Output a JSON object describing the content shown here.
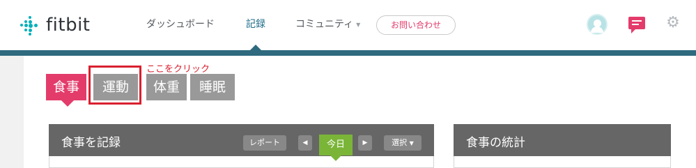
{
  "header": {
    "logo_text": "fitbit",
    "nav": [
      {
        "label": "ダッシュボード"
      },
      {
        "label": "記録"
      },
      {
        "label": "コミュニティ"
      }
    ],
    "contact_label": "お問い合わせ"
  },
  "tabs": [
    {
      "label": "食事"
    },
    {
      "label": "運動"
    },
    {
      "label": "体重"
    },
    {
      "label": "睡眠"
    }
  ],
  "annotation": "ここをクリック",
  "meal_log": {
    "title": "食事を記録",
    "report_label": "レポート",
    "today_label": "今日",
    "select_label": "選択",
    "prev_icon": "◀",
    "next_icon": "▶",
    "dropdown_icon": "▼"
  },
  "meal_stats": {
    "title": "食事の統計"
  },
  "colors": {
    "brand_teal": "#00b0b9",
    "nav_bar": "#2f6a7f",
    "meal_pink": "#e33c6b",
    "today_green": "#7ab538",
    "annotation_red": "#d9202f"
  }
}
